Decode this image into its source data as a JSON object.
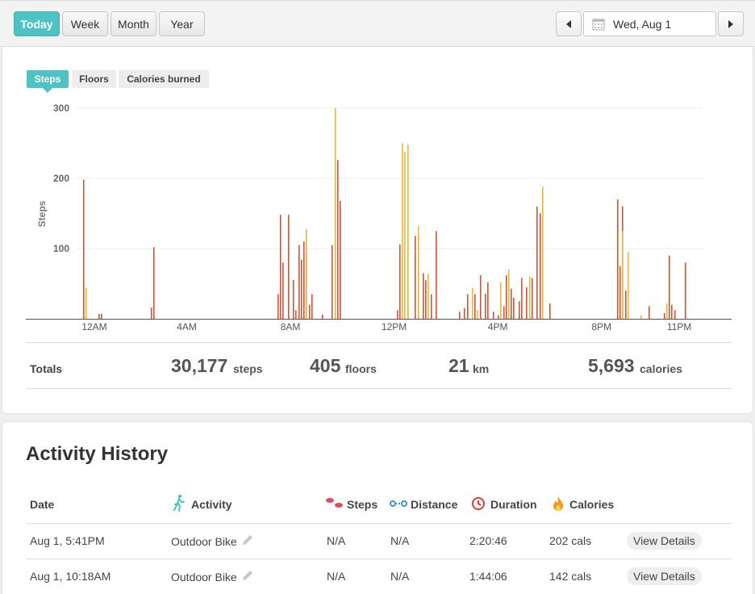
{
  "toolbar": {
    "ranges": [
      "Today",
      "Week",
      "Month",
      "Year"
    ],
    "active_range": "Today",
    "date": "Wed, Aug 1",
    "icons": {
      "prev": "triangle-left-icon",
      "next": "triangle-right-icon",
      "calendar": "calendar-icon"
    }
  },
  "metric_tabs": [
    "Steps",
    "Floors",
    "Calories burned"
  ],
  "active_metric": "Steps",
  "colors": {
    "accent": "#4fc3c4",
    "bar_primary": "#d2533a",
    "bar_secondary": "#e6b83a"
  },
  "chart_data": {
    "type": "bar",
    "ylabel": "Steps",
    "ylim": [
      0,
      300
    ],
    "y_ticks": [
      "100",
      "200",
      "300"
    ],
    "x_tick_labels": [
      "12AM",
      "4AM",
      "8AM",
      "12PM",
      "4PM",
      "8PM",
      "11PM"
    ],
    "x_range_hours": [
      0,
      23.9
    ],
    "series": [
      {
        "color_key": "bar_primary",
        "points": [
          [
            0.0,
            198
          ],
          [
            0.6,
            7
          ],
          [
            0.7,
            7
          ],
          [
            2.6,
            16
          ],
          [
            2.7,
            102
          ],
          [
            7.5,
            35
          ],
          [
            7.6,
            148
          ],
          [
            7.7,
            80
          ],
          [
            7.9,
            148
          ],
          [
            8.1,
            55
          ],
          [
            8.2,
            12
          ],
          [
            8.3,
            105
          ],
          [
            8.4,
            84
          ],
          [
            8.5,
            110
          ],
          [
            8.6,
            92
          ],
          [
            8.7,
            20
          ],
          [
            8.8,
            35
          ],
          [
            9.2,
            6
          ],
          [
            9.6,
            105
          ],
          [
            9.8,
            226
          ],
          [
            9.9,
            168
          ],
          [
            12.1,
            12
          ],
          [
            12.2,
            106
          ],
          [
            12.5,
            12
          ],
          [
            12.8,
            118
          ],
          [
            12.9,
            10
          ],
          [
            13.1,
            65
          ],
          [
            13.2,
            55
          ],
          [
            13.4,
            35
          ],
          [
            13.6,
            125
          ],
          [
            14.5,
            10
          ],
          [
            14.7,
            15
          ],
          [
            14.8,
            35
          ],
          [
            15.1,
            35
          ],
          [
            15.3,
            62
          ],
          [
            15.5,
            36
          ],
          [
            15.6,
            52
          ],
          [
            15.8,
            10
          ],
          [
            16.0,
            5
          ],
          [
            16.2,
            18
          ],
          [
            16.3,
            62
          ],
          [
            16.5,
            43
          ],
          [
            16.6,
            30
          ],
          [
            16.8,
            25
          ],
          [
            16.9,
            58
          ],
          [
            17.1,
            45
          ],
          [
            17.3,
            58
          ],
          [
            17.5,
            160
          ],
          [
            17.6,
            150
          ],
          [
            18.0,
            22
          ],
          [
            20.6,
            170
          ],
          [
            20.7,
            75
          ],
          [
            20.8,
            160
          ],
          [
            20.9,
            40
          ],
          [
            21.8,
            18
          ],
          [
            22.4,
            8
          ],
          [
            22.6,
            90
          ],
          [
            22.7,
            20
          ],
          [
            22.8,
            12
          ],
          [
            23.2,
            80
          ]
        ]
      },
      {
        "color_key": "bar_secondary",
        "points": [
          [
            0.1,
            44
          ],
          [
            8.6,
            128
          ],
          [
            9.7,
            300
          ],
          [
            12.3,
            250
          ],
          [
            12.4,
            238
          ],
          [
            12.5,
            248
          ],
          [
            12.9,
            132
          ],
          [
            13.3,
            64
          ],
          [
            15.0,
            44
          ],
          [
            15.2,
            12
          ],
          [
            16.1,
            52
          ],
          [
            16.4,
            70
          ],
          [
            17.2,
            60
          ],
          [
            17.7,
            188
          ],
          [
            20.8,
            125
          ],
          [
            21.0,
            95
          ],
          [
            21.5,
            5
          ],
          [
            22.5,
            22
          ]
        ]
      }
    ]
  },
  "totals": {
    "label": "Totals",
    "steps": {
      "value": "30,177",
      "unit": "steps"
    },
    "floors": {
      "value": "405",
      "unit": "floors"
    },
    "distance": {
      "value": "21",
      "unit": "km"
    },
    "calories": {
      "value": "5,693",
      "unit": "calories"
    }
  },
  "history": {
    "title": "Activity History",
    "headers": {
      "date": "Date",
      "activity": "Activity",
      "steps": "Steps",
      "distance": "Distance",
      "duration": "Duration",
      "calories": "Calories"
    },
    "header_icons": [
      "walker-icon",
      "footsteps-icon",
      "distance-icon",
      "clock-icon",
      "flame-icon"
    ],
    "rows": [
      {
        "date": "Aug 1, 5:41PM",
        "activity": "Outdoor Bike",
        "steps": "N/A",
        "distance": "N/A",
        "duration": "2:20:46",
        "calories": "202 cals",
        "action": "View Details"
      },
      {
        "date": "Aug 1, 10:18AM",
        "activity": "Outdoor Bike",
        "steps": "N/A",
        "distance": "N/A",
        "duration": "1:44:06",
        "calories": "142 cals",
        "action": "View Details"
      }
    ]
  }
}
